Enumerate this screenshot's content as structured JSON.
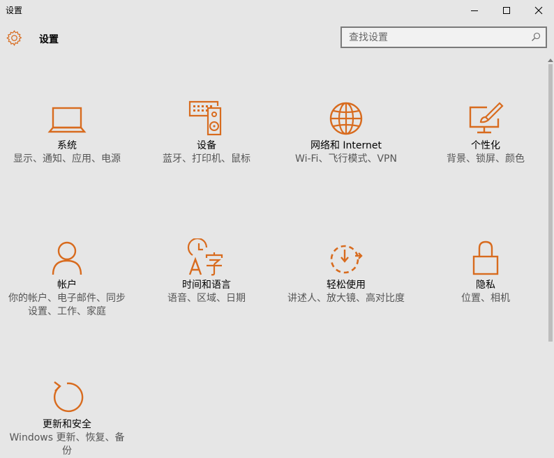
{
  "window": {
    "title": "设置"
  },
  "header": {
    "title": "设置"
  },
  "search": {
    "placeholder": "查找设置"
  },
  "colors": {
    "accent": "#d86b1e",
    "background": "#e6e6e6"
  },
  "tiles": [
    {
      "name": "系统",
      "desc": "显示、通知、应用、电源",
      "icon": "laptop-icon"
    },
    {
      "name": "设备",
      "desc": "蓝牙、打印机、鼠标",
      "icon": "keyboard-speaker-icon"
    },
    {
      "name": "网络和 Internet",
      "desc": "Wi-Fi、飞行模式、VPN",
      "icon": "globe-icon"
    },
    {
      "name": "个性化",
      "desc": "背景、锁屏、颜色",
      "icon": "paint-brush-monitor-icon"
    },
    {
      "name": "帐户",
      "desc": "你的帐户、电子邮件、同步设置、工作、家庭",
      "icon": "person-icon"
    },
    {
      "name": "时间和语言",
      "desc": "语音、区域、日期",
      "icon": "clock-language-icon"
    },
    {
      "name": "轻松使用",
      "desc": "讲述人、放大镜、高对比度",
      "icon": "ease-of-access-icon"
    },
    {
      "name": "隐私",
      "desc": "位置、相机",
      "icon": "lock-icon"
    },
    {
      "name": "更新和安全",
      "desc": "Windows 更新、恢复、备份",
      "icon": "refresh-icon"
    }
  ]
}
